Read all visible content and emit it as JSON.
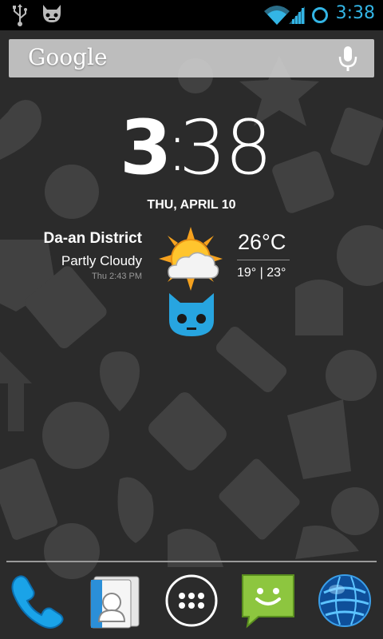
{
  "status_bar": {
    "time": "3:38",
    "icons": [
      "usb-icon",
      "cid-notification-icon",
      "wifi-icon",
      "signal-icon",
      "sync-icon"
    ],
    "accent_color": "#33b5e5"
  },
  "search": {
    "logo_text": "Google",
    "icon": "mic-icon"
  },
  "clock": {
    "hour": "3",
    "separator": ":",
    "minutes": "38",
    "date": "THU, APRIL 10"
  },
  "weather": {
    "location": "Da-an District",
    "condition": "Partly Cloudy",
    "updated": "Thu 2:43 PM",
    "temperature": "26°C",
    "range": "19° | 23°",
    "icon": "partly-cloudy-icon"
  },
  "dock": {
    "items": [
      {
        "name": "Phone",
        "icon": "phone-icon"
      },
      {
        "name": "People",
        "icon": "contacts-icon"
      },
      {
        "name": "Apps",
        "icon": "app-drawer-icon"
      },
      {
        "name": "Messaging",
        "icon": "messaging-icon"
      },
      {
        "name": "Browser",
        "icon": "browser-globe-icon"
      }
    ]
  },
  "colors": {
    "wallpaper_bg": "#2b2b2b",
    "cid_blue": "#27a5e0",
    "messaging_green": "#8dc63f"
  }
}
